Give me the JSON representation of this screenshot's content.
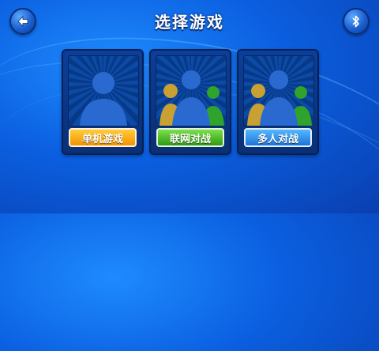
{
  "header": {
    "title": "选择游戏",
    "back_icon": "back-arrow-icon",
    "bluetooth_icon": "bluetooth-icon"
  },
  "modes": [
    {
      "label": "单机游戏",
      "icon": "single-player-icon",
      "color": "#f39200"
    },
    {
      "label": "联网对战",
      "icon": "online-multiplayer-icon",
      "color": "#2f9b12"
    },
    {
      "label": "多人对战",
      "icon": "local-multiplayer-icon",
      "color": "#1d73d8"
    }
  ]
}
